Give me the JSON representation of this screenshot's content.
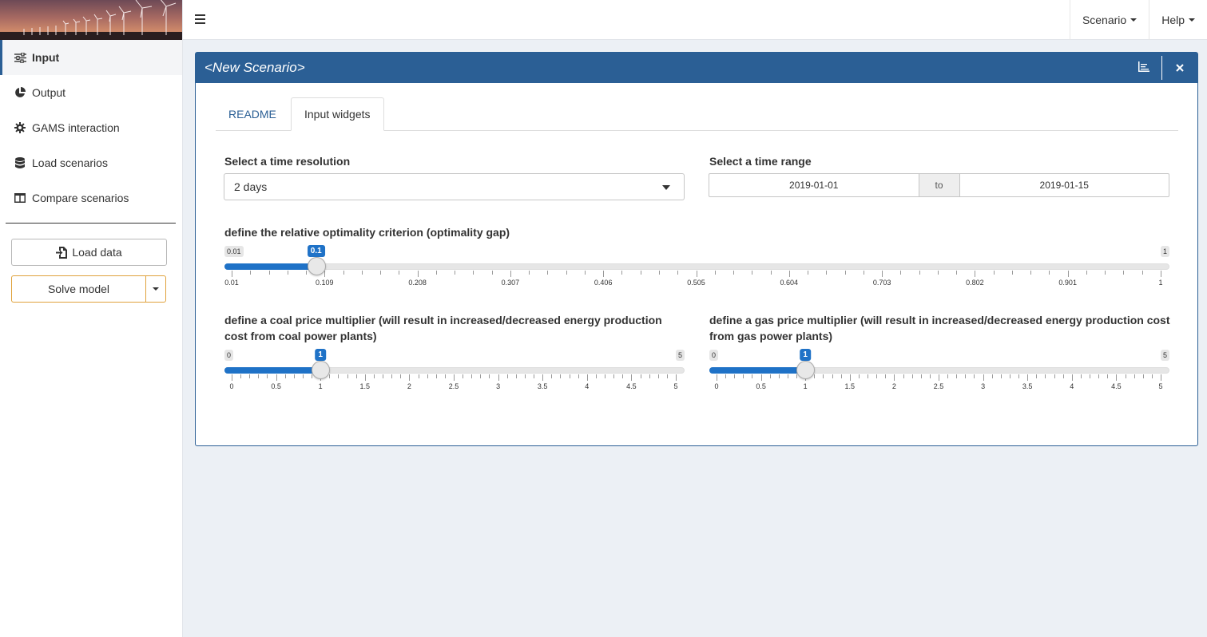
{
  "sidebar": {
    "items": [
      {
        "label": "Input",
        "icon": "sliders-icon",
        "active": true
      },
      {
        "label": "Output",
        "icon": "pie-chart-icon"
      },
      {
        "label": "GAMS interaction",
        "icon": "gear-icon"
      },
      {
        "label": "Load scenarios",
        "icon": "database-icon"
      },
      {
        "label": "Compare scenarios",
        "icon": "columns-icon"
      }
    ],
    "load_data_label": "Load data",
    "solve_model_label": "Solve model"
  },
  "topbar": {
    "scenario_label": "Scenario",
    "help_label": "Help"
  },
  "box": {
    "title": "<New Scenario>",
    "tabs": [
      {
        "label": "README"
      },
      {
        "label": "Input widgets",
        "active": true
      }
    ]
  },
  "time_resolution": {
    "label": "Select a time resolution",
    "value": "2 days"
  },
  "time_range": {
    "label": "Select a time range",
    "start": "2019-01-01",
    "separator": "to",
    "end": "2019-01-15"
  },
  "optimality_gap": {
    "label": "define the relative optimality criterion (optimality gap)",
    "min": 0.01,
    "max": 1,
    "value": 0.1,
    "min_label": "0.01",
    "max_label": "1",
    "value_label": "0.1",
    "tick_labels": [
      "0.01",
      "0.109",
      "0.208",
      "0.307",
      "0.406",
      "0.505",
      "0.604",
      "0.703",
      "0.802",
      "0.901",
      "1"
    ]
  },
  "coal_multiplier": {
    "label": "define a coal price multiplier (will result in increased/decreased energy production cost from coal power plants)",
    "min": 0,
    "max": 5,
    "value": 1,
    "min_label": "0",
    "max_label": "5",
    "value_label": "1",
    "tick_labels": [
      "0",
      "0.5",
      "1",
      "1.5",
      "2",
      "2.5",
      "3",
      "3.5",
      "4",
      "4.5",
      "5"
    ]
  },
  "gas_multiplier": {
    "label": "define a gas price multiplier (will result in increased/decreased energy production cost from gas power plants)",
    "min": 0,
    "max": 5,
    "value": 1,
    "min_label": "0",
    "max_label": "5",
    "value_label": "1",
    "tick_labels": [
      "0",
      "0.5",
      "1",
      "1.5",
      "2",
      "2.5",
      "3",
      "3.5",
      "4",
      "4.5",
      "5"
    ]
  },
  "colors": {
    "primary": "#2b5f95",
    "slider": "#1f72c7",
    "solve_border": "#e0a23c"
  }
}
